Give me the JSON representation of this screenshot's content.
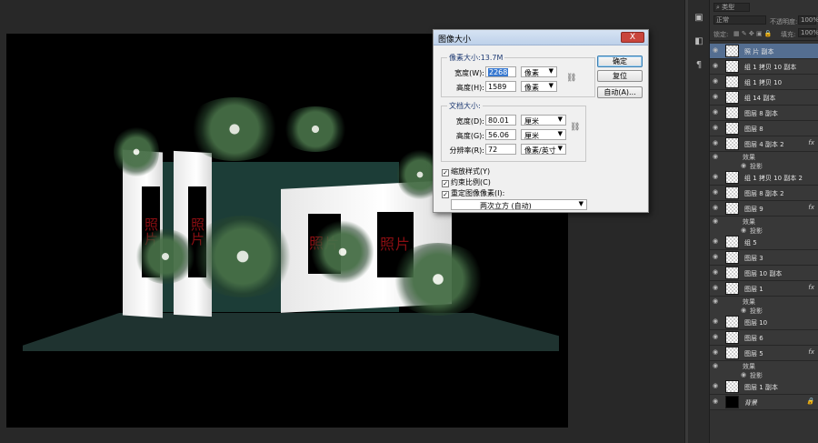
{
  "dialog": {
    "title": "图像大小",
    "close_label": "X",
    "pixel_group": {
      "legend": "像素大小:13.7M",
      "width_label": "宽度(W):",
      "width_value": "2268",
      "width_unit": "像素",
      "height_label": "高度(H):",
      "height_value": "1589",
      "height_unit": "像素"
    },
    "doc_group": {
      "legend": "文档大小:",
      "width_label": "宽度(D):",
      "width_value": "80.01",
      "width_unit": "厘米",
      "height_label": "高度(G):",
      "height_value": "56.06",
      "height_unit": "厘米",
      "res_label": "分辨率(R):",
      "res_value": "72",
      "res_unit": "像素/英寸"
    },
    "options": {
      "scale_styles": "缩放样式(Y)",
      "constrain": "约束比例(C)",
      "resample": "重定图像像素(I):",
      "method": "两次立方 (自动)"
    },
    "buttons": {
      "ok": "确定",
      "reset": "复位",
      "auto": "自动(A)..."
    }
  },
  "canvas": {
    "frame_text": "照片"
  },
  "layers_panel": {
    "kind_filter": "类型",
    "blend_mode": "正常",
    "opacity_label": "不透明度:",
    "opacity_value": "100%",
    "lock_label": "锁定:",
    "fill_label": "填充:",
    "fill_value": "100%",
    "items": [
      {
        "name": "照 片 副本",
        "active": true
      },
      {
        "name": "组 1 拷贝 10 副本"
      },
      {
        "name": "组 1 拷贝 10"
      },
      {
        "name": "组 14 副本"
      },
      {
        "name": "图层 8 副本"
      },
      {
        "name": "图层 8"
      },
      {
        "name": "图层 4 副本 2",
        "fx": "fx"
      },
      {
        "name": "组 1 拷贝 10 副本 2"
      },
      {
        "name": "图层 8 副本 2"
      },
      {
        "name": "图层 9",
        "fx": "fx"
      },
      {
        "name": "组 5"
      },
      {
        "name": "图层 3"
      },
      {
        "name": "图层 10 副本"
      },
      {
        "name": "图层 1",
        "fx": "fx"
      },
      {
        "name": "图层 10"
      },
      {
        "name": "图层 6"
      },
      {
        "name": "图层 5",
        "fx": "fx"
      },
      {
        "name": "图层 1 副本"
      },
      {
        "name": "背景"
      }
    ],
    "effects_label": "效果",
    "shadow_label": "投影"
  },
  "colors": {
    "accent": "#546e91",
    "frame_text": "#8b0e12",
    "dark_green": "#1c3d37"
  }
}
